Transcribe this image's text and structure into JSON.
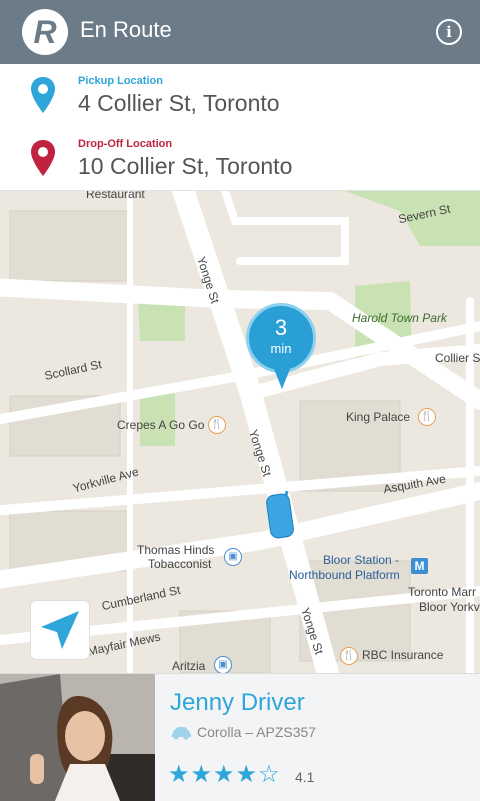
{
  "header": {
    "logo_letter": "R",
    "title": "En Route",
    "info_icon": "info-icon"
  },
  "pickup": {
    "label": "Pickup Location",
    "address": "4 Collier St, Toronto",
    "color": "#2ea6d9"
  },
  "dropoff": {
    "label": "Drop-Off Location",
    "address": "10 Collier St, Toronto",
    "color": "#c0233e"
  },
  "map": {
    "labels": {
      "restaurant": "Restaurant",
      "severn": "Severn St",
      "yonge_top": "Yonge St",
      "harold": "Harold Town Park",
      "collier": "Collier St",
      "scollard": "Scollard St",
      "king_palace": "King Palace",
      "crepes": "Crepes A Go Go",
      "yonge_mid": "Yonge St",
      "yorkville": "Yorkville Ave",
      "asquith": "Asquith Ave",
      "thomas1": "Thomas Hinds",
      "thomas2": "Tobacconist",
      "bloor1": "Bloor Station -",
      "bloor2": "Northbound Platform",
      "cumberland": "Cumberland St",
      "toronto_marr": "Toronto Marr",
      "bloor_york": "Bloor Yorkv",
      "mayfair": "Mayfair Mews",
      "yonge_bot": "Yonge St",
      "aritzia": "Aritzia",
      "rbc": "RBC Insurance"
    },
    "eta": {
      "value": "3",
      "unit": "min"
    },
    "metro_letter": "M"
  },
  "driver": {
    "name": "Jenny Driver",
    "car": "Corolla – APZS357",
    "stars": "★★★★",
    "empty_star": "☆",
    "rating": "4.1",
    "rating_value": 4.1
  }
}
